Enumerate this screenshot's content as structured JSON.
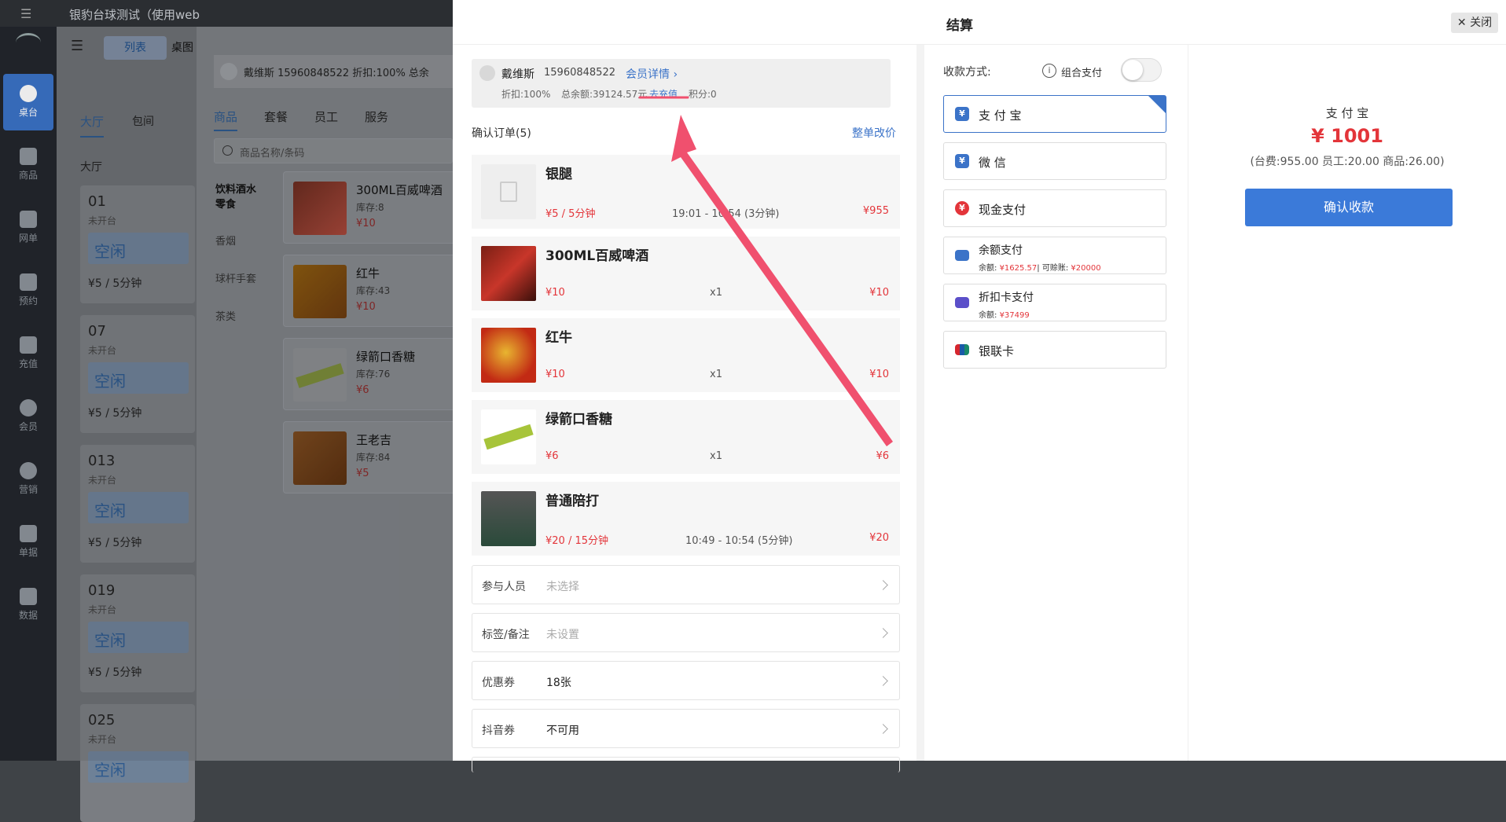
{
  "bg": {
    "window_title": "银豹台球测试（使用web",
    "tab_list": "列表",
    "tab_table": "桌图",
    "nav": [
      "桌台",
      "商品",
      "网单",
      "预约",
      "充值",
      "会员",
      "营销",
      "单据",
      "数据"
    ],
    "hall_tabs": [
      "大厅",
      "包间"
    ],
    "section": "大厅",
    "tables": [
      {
        "num": "01",
        "status": "未开台",
        "state": "空闲",
        "price": "¥5 / 5分钟"
      },
      {
        "num": "07",
        "status": "未开台",
        "state": "空闲",
        "price": "¥5 / 5分钟"
      },
      {
        "num": "013",
        "status": "未开台",
        "state": "空闲",
        "price": "¥5 / 5分钟"
      },
      {
        "num": "019",
        "status": "未开台",
        "state": "空闲",
        "price": "¥5 / 5分钟"
      },
      {
        "num": "025",
        "status": "未开台",
        "state": "空闲",
        "price": ""
      }
    ],
    "member_line": "戴维斯  15960848522   折扣:100%   总余",
    "goods_tabs": [
      "商品",
      "套餐",
      "员工",
      "服务"
    ],
    "search_placeholder": "商品名称/条码",
    "categories": [
      "饮料酒水零食",
      "香烟",
      "球杆手套",
      "茶类"
    ],
    "goods": [
      {
        "name": "300ML百威啤酒",
        "stock": "库存:8",
        "price": "¥10"
      },
      {
        "name": "红牛",
        "stock": "库存:43",
        "price": "¥10"
      },
      {
        "name": "绿箭口香糖",
        "stock": "库存:76",
        "price": "¥6"
      },
      {
        "name": "王老吉",
        "stock": "库存:84",
        "price": "¥5"
      }
    ]
  },
  "modal": {
    "title": "结算",
    "close": "关闭",
    "member": {
      "name": "戴维斯",
      "phone": "15960848522",
      "detail_link": "会员详情",
      "discount": "折扣:100%",
      "balance": "总余额:39124.57元",
      "recharge": "去充值",
      "points": "积分:0"
    },
    "order_title": "确认订单(5)",
    "reprice": "整单改价",
    "items": [
      {
        "name": "银腿",
        "price": "¥5 / 5分钟",
        "meta": "19:01 - 10:54 (3分钟)",
        "total": "¥955"
      },
      {
        "name": "300ML百威啤酒",
        "price": "¥10",
        "meta": "x1",
        "total": "¥10"
      },
      {
        "name": "红牛",
        "price": "¥10",
        "meta": "x1",
        "total": "¥10"
      },
      {
        "name": "绿箭口香糖",
        "price": "¥6",
        "meta": "x1",
        "total": "¥6"
      },
      {
        "name": "普通陪打",
        "price": "¥20 / 15分钟",
        "meta": "10:49 - 10:54 (5分钟)",
        "total": "¥20"
      }
    ],
    "rows": [
      {
        "label": "参与人员",
        "value": "未选择",
        "placeholder": true
      },
      {
        "label": "标签/备注",
        "value": "未设置",
        "placeholder": true
      },
      {
        "label": "优惠券",
        "value": "18张",
        "placeholder": false
      },
      {
        "label": "抖音券",
        "value": "不可用",
        "placeholder": false
      }
    ],
    "payment": {
      "label": "收款方式:",
      "combo": "组合支付",
      "methods": [
        {
          "name": "支 付 宝",
          "icon": "alipay-icon",
          "color": "#3b73c8",
          "selected": true
        },
        {
          "name": "微 信",
          "icon": "wechat-pay-icon",
          "color": "#3b73c8"
        },
        {
          "name": "现金支付",
          "icon": "cash-icon",
          "color": "#e3353a"
        },
        {
          "name": "余额支付",
          "icon": "wallet-icon",
          "color": "#3b73c8",
          "sub_prefix": "余额: ",
          "sub_value": "¥1625.57",
          "sub_sep": "| 可赊账: ",
          "sub_value2": "¥20000"
        },
        {
          "name": "折扣卡支付",
          "icon": "card-icon",
          "color": "#5b4fc9",
          "sub_prefix": "余额: ",
          "sub_value": "¥37499"
        },
        {
          "name": "银联卡",
          "icon": "unionpay-icon",
          "color": "#d6262e"
        }
      ]
    },
    "summary": {
      "method": "支 付 宝",
      "amount": "¥ 1001",
      "breakdown": "(台费:955.00  员工:20.00  商品:26.00)",
      "confirm": "确认收款"
    },
    "colors": {
      "accent": "#3b73c8",
      "price_red": "#e3353a",
      "annotation": "#f0506e"
    }
  }
}
